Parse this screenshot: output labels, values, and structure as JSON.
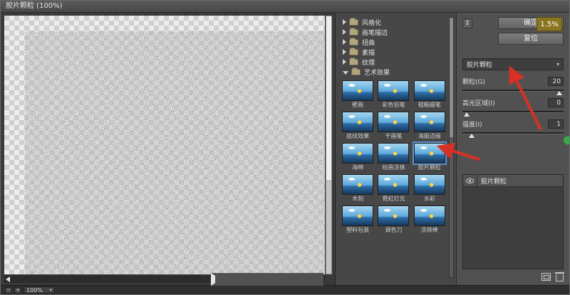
{
  "window": {
    "title": "胶片颗粒 (100%)"
  },
  "categories": [
    {
      "label": "风格化"
    },
    {
      "label": "画笔描边"
    },
    {
      "label": "扭曲"
    },
    {
      "label": "素描"
    },
    {
      "label": "纹理"
    },
    {
      "label": "艺术效果"
    }
  ],
  "thumbnails": [
    {
      "label": "壁画"
    },
    {
      "label": "彩色铅笔"
    },
    {
      "label": "粗糙蜡笔"
    },
    {
      "label": "底纹效果"
    },
    {
      "label": "干画笔"
    },
    {
      "label": "海报边缘"
    },
    {
      "label": "海绵"
    },
    {
      "label": "绘画涂抹"
    },
    {
      "label": "胶片颗粒"
    },
    {
      "label": "木刻"
    },
    {
      "label": "霓虹灯光"
    },
    {
      "label": "水彩"
    },
    {
      "label": "塑料包装"
    },
    {
      "label": "调色刀"
    },
    {
      "label": "涂抹棒"
    }
  ],
  "selected_thumbnail": "胶片颗粒",
  "right_panel": {
    "ok_label": "确定",
    "reset_label": "复位",
    "badge": "1.5%",
    "filter_select": "胶片颗粒",
    "sliders": [
      {
        "label": "颗粒(G)",
        "value": "20"
      },
      {
        "label": "高光区域(I)",
        "value": "0"
      },
      {
        "label": "强度(I)",
        "value": "1"
      }
    ],
    "effect_layers": [
      {
        "name": "胶片颗粒"
      }
    ]
  },
  "statusbar": {
    "zoom": "100%"
  },
  "colors": {
    "badge_bg": "#8a7420",
    "arrow": "#d93025",
    "dot": "#39a84e"
  }
}
